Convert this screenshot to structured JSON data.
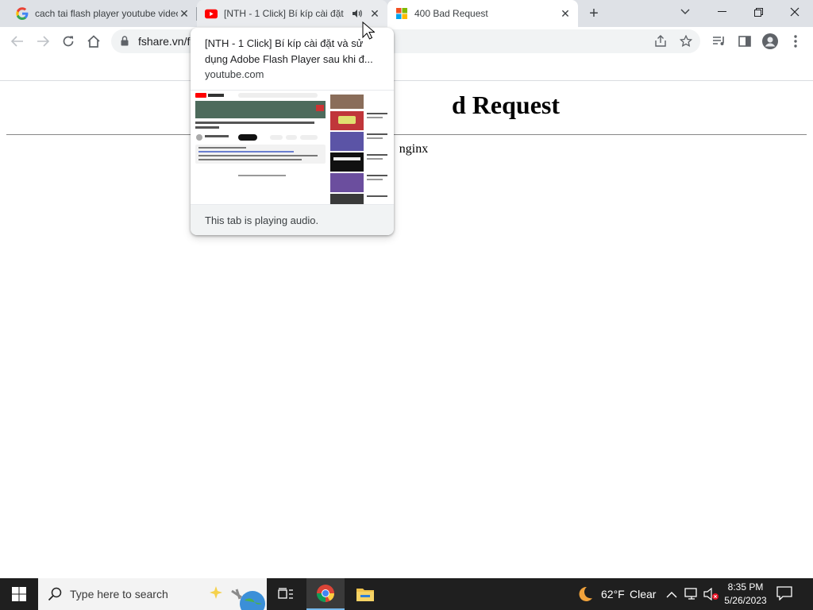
{
  "browser": {
    "tabs": [
      {
        "title": "cach tai flash player youtube video",
        "favicon": "google-g-icon"
      },
      {
        "title": "[NTH - 1 Click] Bí kíp cài đặt",
        "favicon": "youtube-icon",
        "audio": "speaker-icon"
      },
      {
        "title": "400 Bad Request",
        "favicon": "windows-logo-icon"
      }
    ],
    "new_tab_symbol": "+",
    "address": "fshare.vn/f",
    "colors": {
      "tabstrip": "#dee1e6",
      "active_tab": "#ffffff",
      "omnibox": "#f1f3f4"
    }
  },
  "page": {
    "heading": "d Request",
    "server": "nginx"
  },
  "hovercard": {
    "title": "[NTH - 1 Click] Bí kíp cài đặt và sử dụng Adobe Flash Player sau khi đ...",
    "domain": "youtube.com",
    "footer": "This tab is playing audio."
  },
  "taskbar": {
    "search_placeholder": "Type here to search",
    "weather_temp": "62°F",
    "weather_desc": "Clear",
    "time": "8:35 PM",
    "date": "5/26/2023"
  }
}
